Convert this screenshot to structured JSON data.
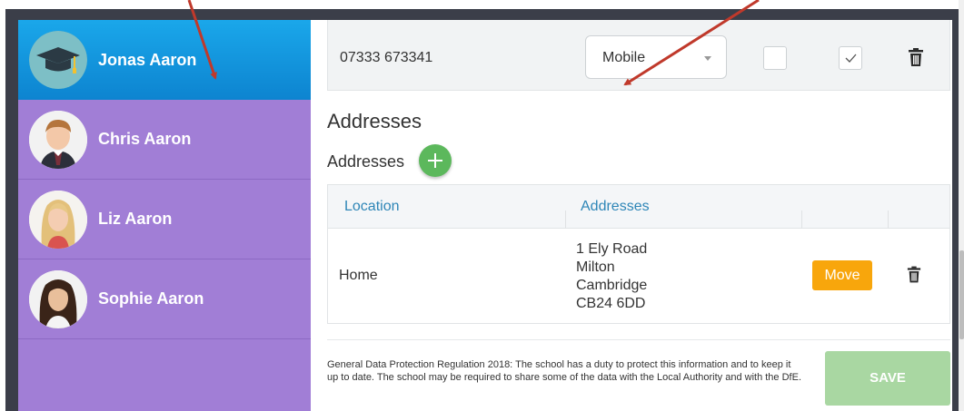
{
  "students": [
    {
      "name": "Jonas Aaron",
      "active": true,
      "avatar": "graduation-cap-icon"
    },
    {
      "name": "Chris Aaron",
      "active": false,
      "avatar": "boy-photo"
    },
    {
      "name": "Liz Aaron",
      "active": false,
      "avatar": "girl-photo"
    },
    {
      "name": "Sophie Aaron",
      "active": false,
      "avatar": "girl-photo"
    }
  ],
  "phone": {
    "number": "07333 673341",
    "type": "Mobile",
    "checkbox_1_checked": false,
    "checkbox_2_checked": true
  },
  "addresses": {
    "section_title": "Addresses",
    "subtitle": "Addresses",
    "columns": [
      "Location",
      "Addresses"
    ],
    "rows": [
      {
        "location": "Home",
        "lines": [
          "1 Ely Road",
          "Milton",
          "Cambridge",
          "CB24 6DD"
        ],
        "action_label": "Move"
      }
    ]
  },
  "footer": {
    "gdpr_text": "General Data Protection Regulation 2018: The school has a duty to protect this information and to keep it up to date. The school may be required to share some of the data with the Local Authority and with the DfE.",
    "save_label": "SAVE"
  },
  "colors": {
    "sidebar": "#a17ed6",
    "active_student": "#0d84d0",
    "add_button": "#5cb85c",
    "move_button": "#f8a60c",
    "save_button": "#a9d7a2",
    "header_link": "#2e86b7",
    "annotation_arrow": "#c0392b"
  }
}
